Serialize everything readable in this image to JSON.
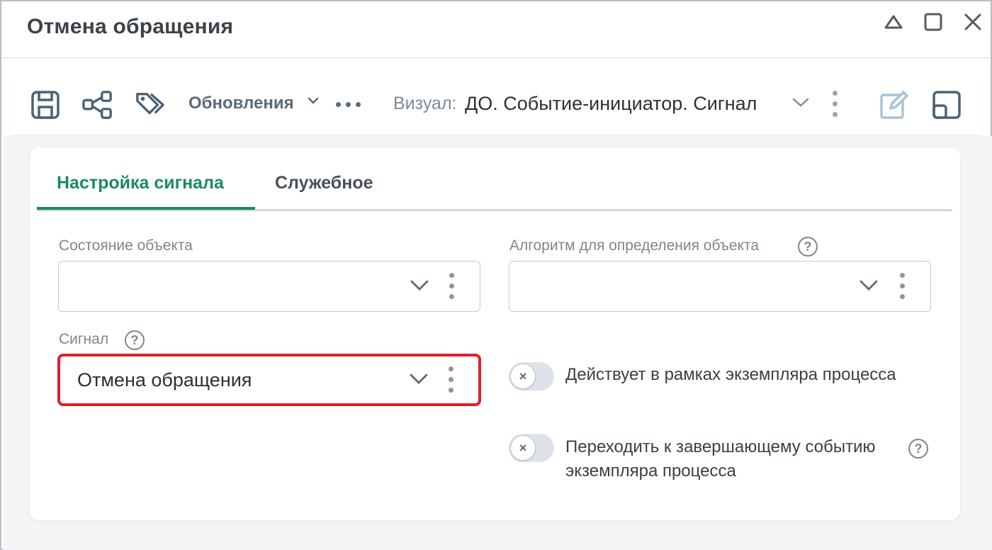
{
  "window": {
    "title": "Отмена обращения",
    "controls": [
      "collapse-icon",
      "maximize-icon",
      "close-icon"
    ]
  },
  "toolbar": {
    "icons": [
      "save-icon",
      "share-icon",
      "tags-icon"
    ],
    "updates_label": "Обновления",
    "more_icon": "more-horizontal-icon",
    "visual_label": "Визуал:",
    "visual_value": "ДО. Событие-инициатор. Сигнал",
    "right_icons": [
      "edit-icon",
      "layout-icon"
    ]
  },
  "tabs": [
    {
      "label": "Настройка сигнала",
      "active": true
    },
    {
      "label": "Служебное",
      "active": false
    }
  ],
  "form": {
    "object_state": {
      "label": "Состояние объекта",
      "value": ""
    },
    "algorithm": {
      "label": "Алгоритм для определения объекта",
      "value": ""
    },
    "signal": {
      "label": "Сигнал",
      "value": "Отмена обращения"
    },
    "help_glyph": "?"
  },
  "toggles": [
    {
      "label": "Действует в рамках экземпляра процесса",
      "checked": false
    },
    {
      "label_line1": "Переходить к завершающему событию",
      "label_line2": "экземпляра процесса",
      "checked": false
    }
  ],
  "toggle_off_glyph": "×",
  "colors": {
    "accent": "#1d8a5c",
    "highlight": "#e01e2f"
  }
}
